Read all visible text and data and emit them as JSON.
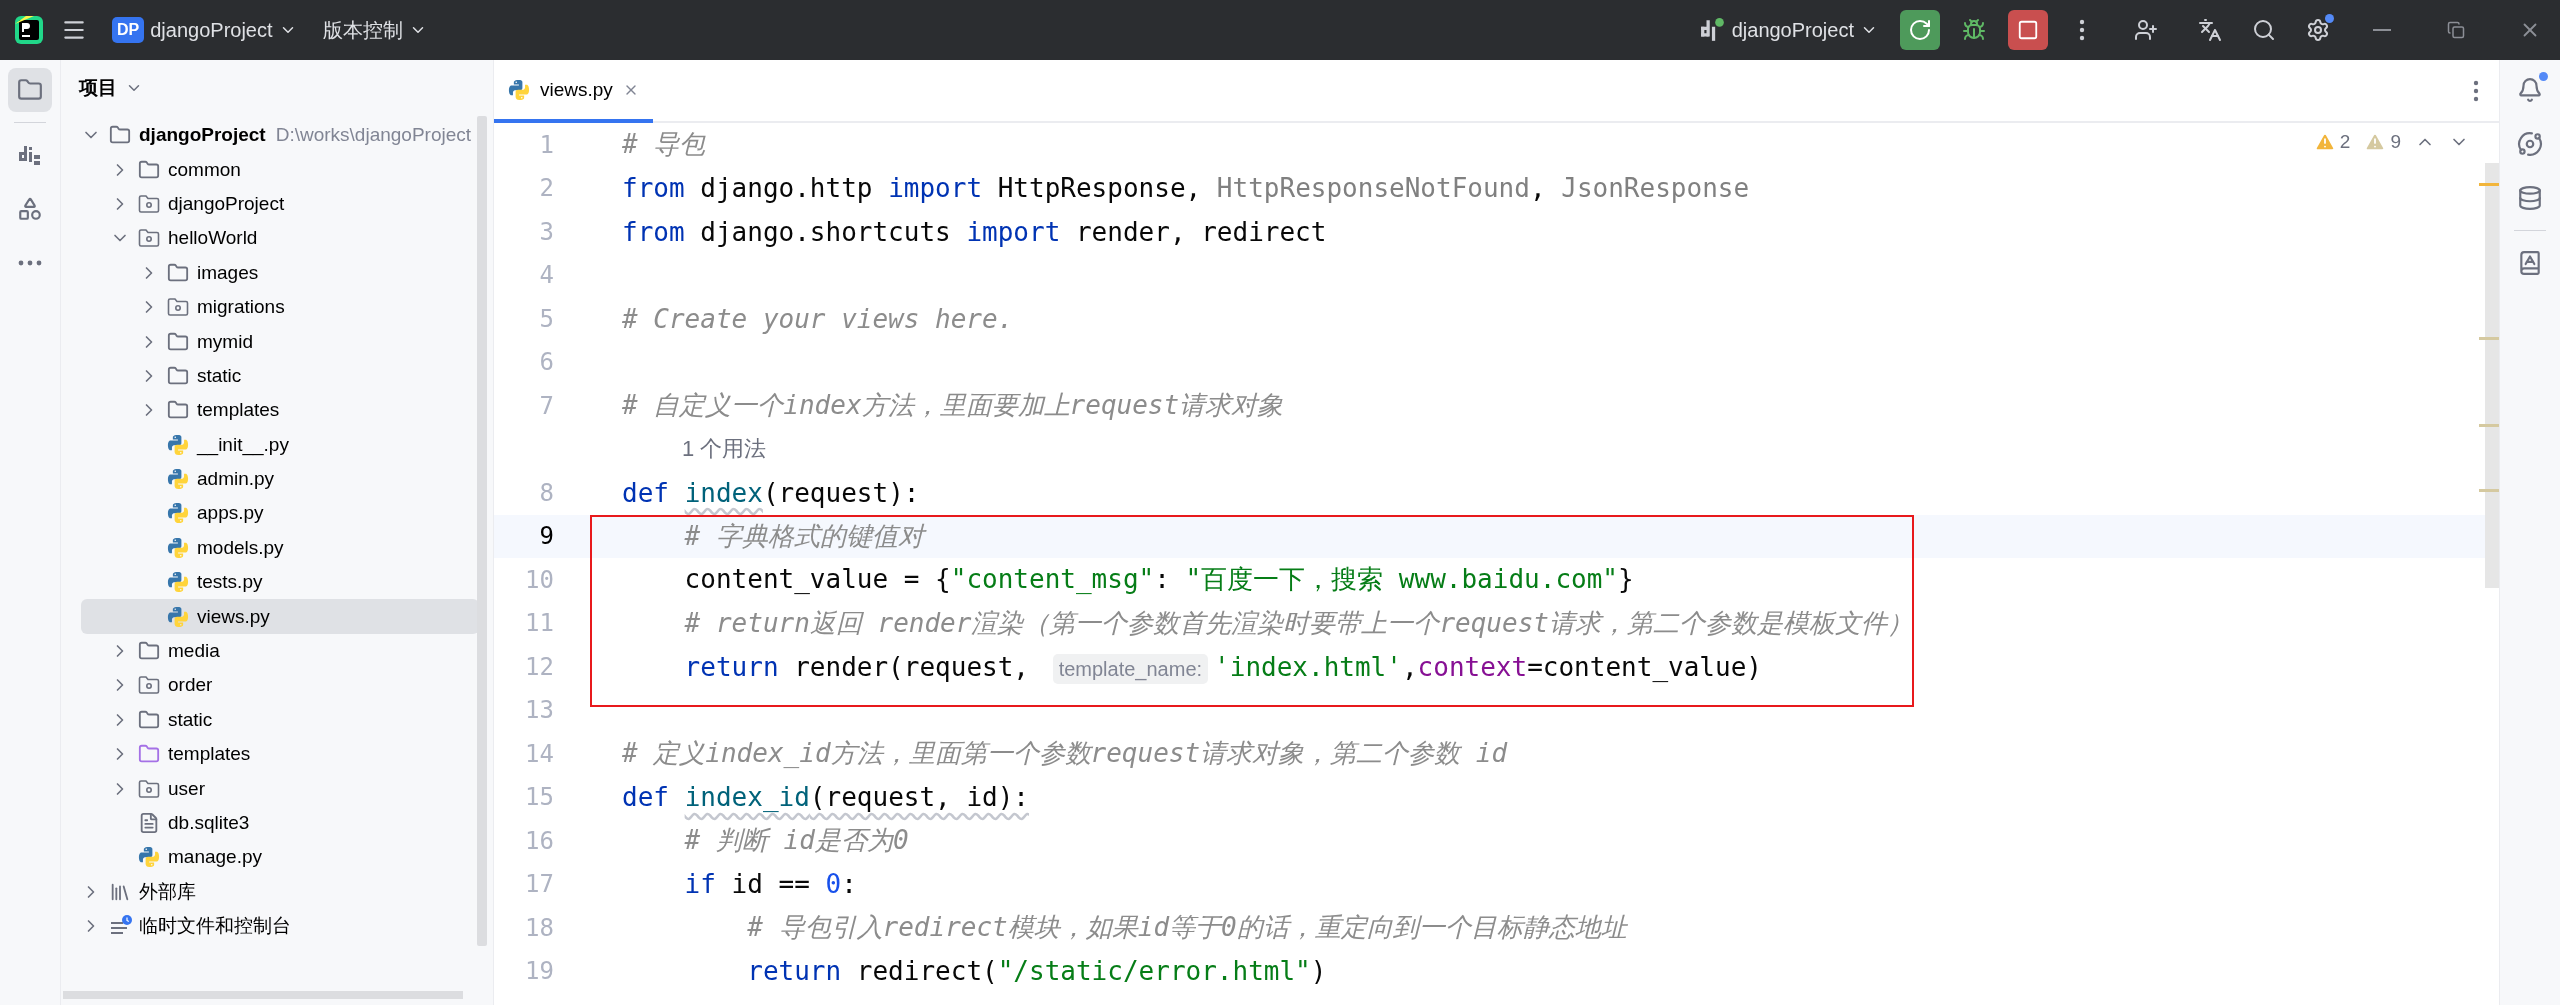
{
  "title_bar": {
    "project_badge": "DP",
    "project_name": "djangoProject",
    "vcs_menu": "版本控制",
    "run_config": "djangoProject",
    "settings_update_dot": true
  },
  "left_toolbar": [
    {
      "kind": "project",
      "selected": true
    },
    {
      "kind": "django",
      "selected": false
    },
    {
      "kind": "structure",
      "selected": false
    },
    {
      "kind": "more",
      "selected": false
    }
  ],
  "project_panel": {
    "title": "项目",
    "tree": [
      {
        "name": "djangoProject",
        "kind": "folder",
        "expanded": true,
        "selected": false,
        "path": "D:\\works\\djangoProject",
        "children": [
          {
            "name": "common",
            "kind": "folder",
            "expanded": false,
            "selected": false
          },
          {
            "name": "djangoProject",
            "kind": "module",
            "expanded": false,
            "selected": false
          },
          {
            "name": "helloWorld",
            "kind": "module",
            "expanded": true,
            "selected": false,
            "children": [
              {
                "name": "images",
                "kind": "folder",
                "expanded": false,
                "selected": false
              },
              {
                "name": "migrations",
                "kind": "module",
                "expanded": false,
                "selected": false
              },
              {
                "name": "mymid",
                "kind": "folder",
                "expanded": false,
                "selected": false
              },
              {
                "name": "static",
                "kind": "folder",
                "expanded": false,
                "selected": false
              },
              {
                "name": "templates",
                "kind": "folder",
                "expanded": false,
                "selected": false
              },
              {
                "name": "__init__.py",
                "kind": "python",
                "selected": false
              },
              {
                "name": "admin.py",
                "kind": "python",
                "selected": false
              },
              {
                "name": "apps.py",
                "kind": "python",
                "selected": false
              },
              {
                "name": "models.py",
                "kind": "python",
                "selected": false
              },
              {
                "name": "tests.py",
                "kind": "python",
                "selected": false
              },
              {
                "name": "views.py",
                "kind": "python",
                "selected": true
              }
            ]
          },
          {
            "name": "media",
            "kind": "folder",
            "expanded": false,
            "selected": false
          },
          {
            "name": "order",
            "kind": "module",
            "expanded": false,
            "selected": false
          },
          {
            "name": "static",
            "kind": "folder",
            "expanded": false,
            "selected": false
          },
          {
            "name": "templates",
            "kind": "templates",
            "expanded": false,
            "selected": false
          },
          {
            "name": "user",
            "kind": "module",
            "expanded": false,
            "selected": false
          },
          {
            "name": "db.sqlite3",
            "kind": "text",
            "selected": false
          },
          {
            "name": "manage.py",
            "kind": "python",
            "selected": false
          }
        ]
      },
      {
        "name": "外部库",
        "kind": "library",
        "expanded": false,
        "selected": false
      },
      {
        "name": "临时文件和控制台",
        "kind": "scratch",
        "expanded": false,
        "selected": false
      }
    ]
  },
  "editor": {
    "tabs": [
      {
        "label": "views.py",
        "selected": true
      }
    ],
    "inspections": [
      {
        "kind": "warning",
        "count": "2"
      },
      {
        "kind": "weak",
        "count": "9"
      }
    ],
    "lines": [
      {
        "number": "1",
        "tokens": [
          {
            "kind": "comment",
            "text": "# 导包"
          }
        ]
      },
      {
        "number": "2",
        "tokens": [
          {
            "kind": "keyword",
            "text": "from"
          },
          {
            "kind": "plain",
            "text": " django.http "
          },
          {
            "kind": "keyword",
            "text": "import"
          },
          {
            "kind": "plain",
            "text": " HttpResponse, "
          },
          {
            "kind": "unused",
            "text": "HttpResponseNotFound"
          },
          {
            "kind": "plain",
            "text": ", "
          },
          {
            "kind": "unused",
            "text": "JsonResponse"
          }
        ]
      },
      {
        "number": "3",
        "tokens": [
          {
            "kind": "keyword",
            "text": "from"
          },
          {
            "kind": "plain",
            "text": " django.shortcuts "
          },
          {
            "kind": "keyword",
            "text": "import"
          },
          {
            "kind": "plain",
            "text": " render, redirect"
          }
        ]
      },
      {
        "number": "4"
      },
      {
        "number": "5",
        "tokens": [
          {
            "kind": "comment",
            "text": "# Create your views here."
          }
        ]
      },
      {
        "number": "6"
      },
      {
        "number": "7",
        "tokens": [
          {
            "kind": "comment",
            "text": "# 自定义一个index方法，里面要加上request请求对象"
          }
        ]
      },
      {
        "kind": "usages",
        "text": "1 个用法"
      },
      {
        "number": "8",
        "tokens": [
          {
            "kind": "keyword",
            "text": "def "
          },
          {
            "kind": "func",
            "text": "index",
            "warn": true
          },
          {
            "kind": "plain",
            "text": "(request):"
          }
        ]
      },
      {
        "number": "9",
        "current": true,
        "boxed": true,
        "tokens": [
          {
            "kind": "comment",
            "text": "    # 字典格式的键值对"
          }
        ]
      },
      {
        "number": "10",
        "boxed": true,
        "tokens": [
          {
            "kind": "plain",
            "text": "    content_value = {"
          },
          {
            "kind": "string",
            "text": "\"content_msg\""
          },
          {
            "kind": "plain",
            "text": ": "
          },
          {
            "kind": "string",
            "text": "\"百度一下，搜索 www.baidu.com\""
          },
          {
            "kind": "plain",
            "text": "}"
          }
        ]
      },
      {
        "number": "11",
        "boxed": true,
        "tokens": [
          {
            "kind": "comment",
            "text": "    # return返回 render渲染（第一个参数首先渲染时要带上一个request请求，第二个参数是模板文件）"
          }
        ]
      },
      {
        "number": "12",
        "boxed": true,
        "tokens": [
          {
            "kind": "keyword",
            "text": "    return"
          },
          {
            "kind": "plain",
            "text": " render(request, "
          },
          {
            "kind": "inlay",
            "text": "template_name:"
          },
          {
            "kind": "string",
            "text": "'index.html'"
          },
          {
            "kind": "plain",
            "text": ","
          },
          {
            "kind": "param",
            "text": "context"
          },
          {
            "kind": "plain",
            "text": "=content_value)"
          }
        ]
      },
      {
        "number": "13"
      },
      {
        "number": "14",
        "tokens": [
          {
            "kind": "comment",
            "text": "# 定义index_id方法，里面第一个参数request请求对象，第二个参数 id"
          }
        ]
      },
      {
        "number": "15",
        "tokens": [
          {
            "kind": "keyword",
            "text": "def "
          },
          {
            "kind": "func",
            "text": "index_id",
            "warn": true
          },
          {
            "kind": "plain",
            "text": "(request, id):",
            "warn": true
          }
        ]
      },
      {
        "number": "16",
        "tokens": [
          {
            "kind": "comment",
            "text": "    # 判断 id是否为0"
          }
        ]
      },
      {
        "number": "17",
        "tokens": [
          {
            "kind": "keyword",
            "text": "    if"
          },
          {
            "kind": "plain",
            "text": " id == "
          },
          {
            "kind": "number",
            "text": "0"
          },
          {
            "kind": "plain",
            "text": ":"
          }
        ]
      },
      {
        "number": "18",
        "tokens": [
          {
            "kind": "comment",
            "text": "        # 导包引入redirect模块，如果id等于0的话，重定向到一个目标静态地址"
          }
        ]
      },
      {
        "number": "19",
        "tokens": [
          {
            "kind": "keyword",
            "text": "        return"
          },
          {
            "kind": "plain",
            "text": " redirect("
          },
          {
            "kind": "string",
            "text": "\"/static/error.html\""
          },
          {
            "kind": "plain",
            "text": ")"
          }
        ]
      }
    ]
  },
  "right_toolbar": [
    {
      "kind": "notifications",
      "dot": true
    },
    {
      "kind": "ai"
    },
    {
      "kind": "database"
    },
    {
      "kind": "divider"
    },
    {
      "kind": "dictionary"
    }
  ]
}
